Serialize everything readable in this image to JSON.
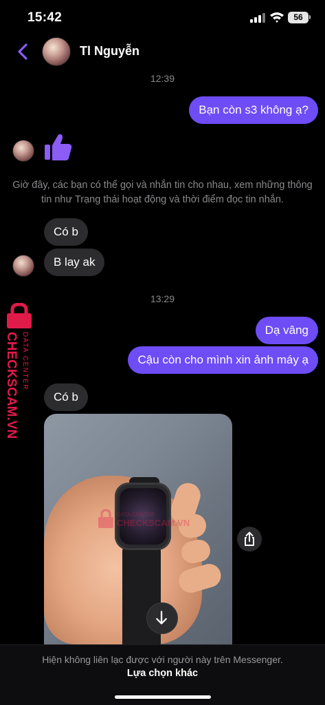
{
  "status_bar": {
    "time": "15:42",
    "battery": "56"
  },
  "header": {
    "contact_name": "Tl Nguyễn"
  },
  "messages": {
    "time_1": "12:39",
    "out_1": "Bạn còn s3 không ạ?",
    "notice": "Giờ đây, các bạn có thể gọi và nhắn tin cho nhau, xem những thông tin như Trạng thái hoạt động và thời điểm đọc tin nhắn.",
    "in_1": "Có b",
    "in_2": "B lay ak",
    "time_2": "13:29",
    "out_2": "Dạ vâng",
    "out_3": "Cậu còn cho mình xin ảnh máy ạ",
    "in_3": "Có b"
  },
  "watermark": {
    "brand": "CHECKSCAM.VN",
    "sub": "DATA CENTER"
  },
  "footer": {
    "notice": "Hiện không liên lạc được với người này trên Messenger.",
    "link": "Lựa chọn khác"
  },
  "colors": {
    "outgoing_bubble": "#6e4cf6",
    "incoming_bubble": "#2c2c2e",
    "accent": "#8b5cf6",
    "watermark": "#e01b4a"
  },
  "icons": [
    "back-chevron-icon",
    "thumbs-up-icon",
    "share-icon",
    "arrow-down-icon",
    "lock-icon",
    "signal-icon",
    "wifi-icon",
    "battery-icon"
  ]
}
